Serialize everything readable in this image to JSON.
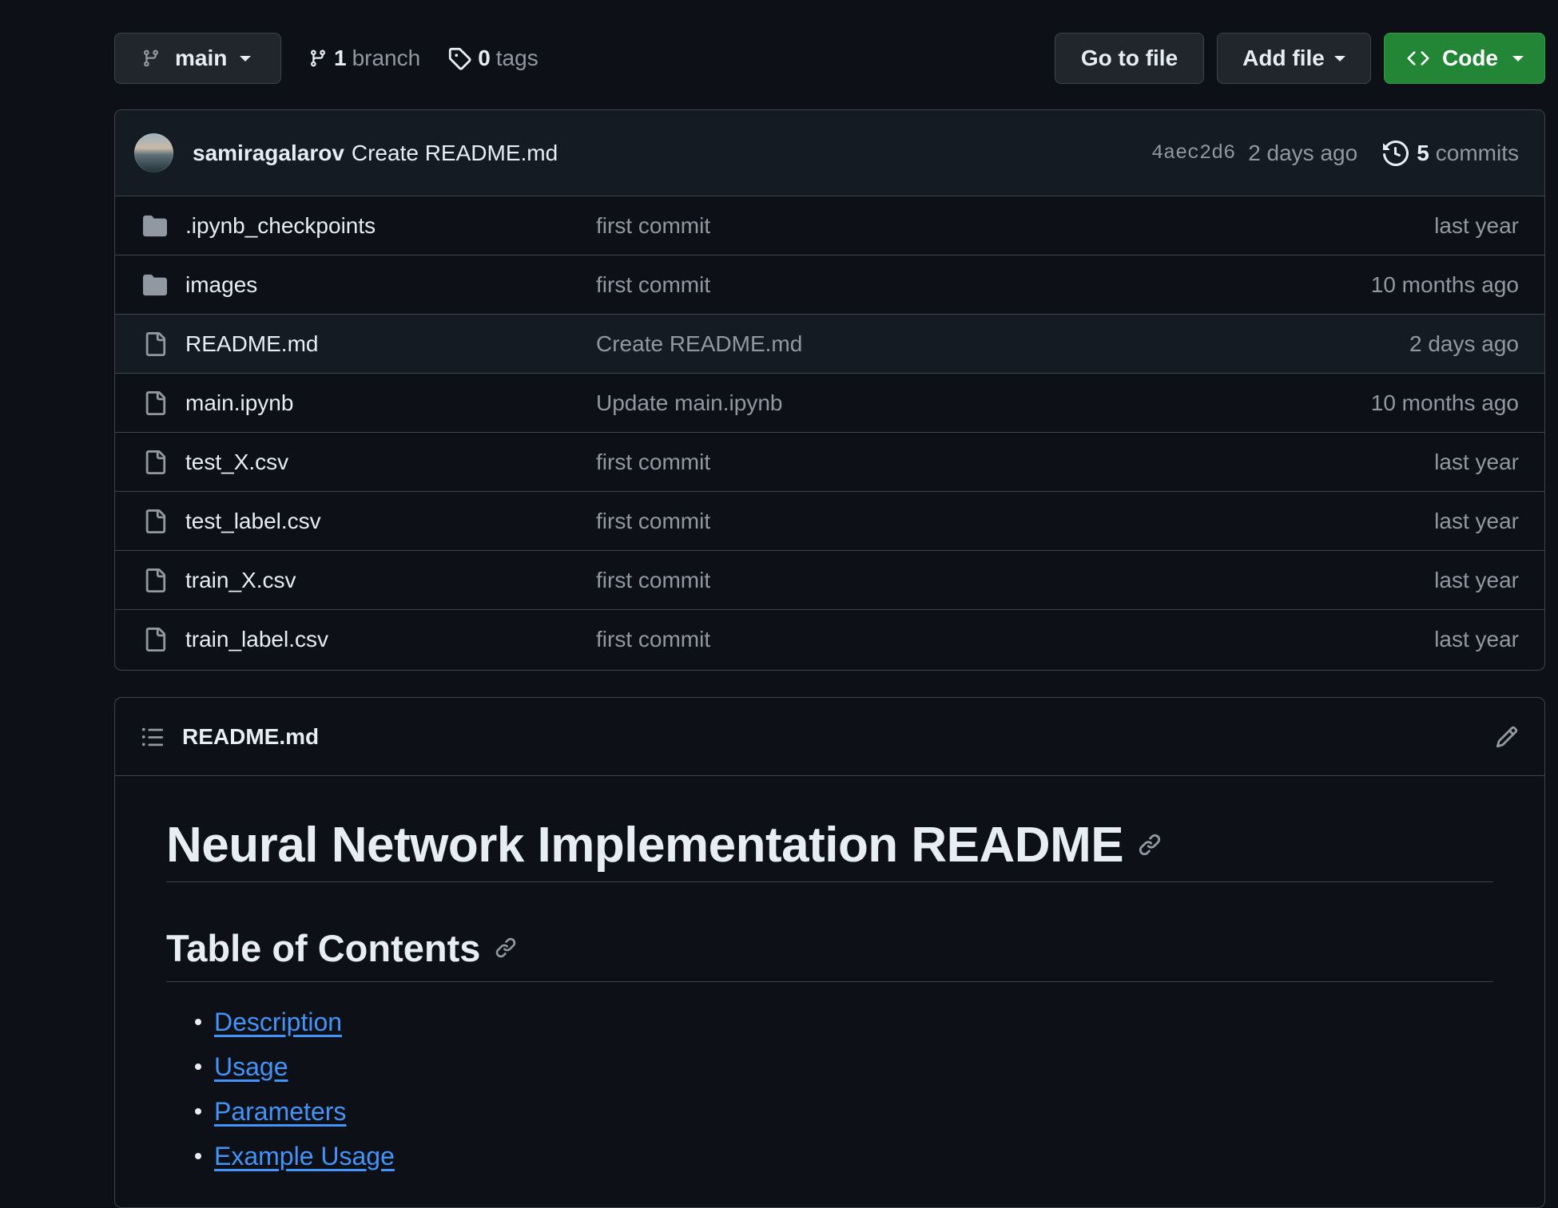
{
  "toolbar": {
    "branch_name": "main",
    "branch_count": "1",
    "branch_label": "branch",
    "tag_count": "0",
    "tag_label": "tags",
    "goto_label": "Go to file",
    "add_label": "Add file",
    "code_label": "Code",
    "code_color": "#238636"
  },
  "latest_commit": {
    "author": "samiragalarov",
    "message": "Create README.md",
    "sha": "4aec2d6",
    "date": "2 days ago",
    "commit_count": "5",
    "commit_label": "commits"
  },
  "files": [
    {
      "type": "folder",
      "name": ".ipynb_checkpoints",
      "message": "first commit",
      "age": "last year"
    },
    {
      "type": "folder",
      "name": "images",
      "message": "first commit",
      "age": "10 months ago"
    },
    {
      "type": "file",
      "name": "README.md",
      "message": "Create README.md",
      "age": "2 days ago"
    },
    {
      "type": "file",
      "name": "main.ipynb",
      "message": "Update main.ipynb",
      "age": "10 months ago"
    },
    {
      "type": "file",
      "name": "test_X.csv",
      "message": "first commit",
      "age": "last year"
    },
    {
      "type": "file",
      "name": "test_label.csv",
      "message": "first commit",
      "age": "last year"
    },
    {
      "type": "file",
      "name": "train_X.csv",
      "message": "first commit",
      "age": "last year"
    },
    {
      "type": "file",
      "name": "train_label.csv",
      "message": "first commit",
      "age": "last year"
    }
  ],
  "readme": {
    "file_title": "README.md",
    "h1": "Neural Network Implementation README",
    "h2": "Table of Contents",
    "toc": [
      "Description",
      "Usage",
      "Parameters",
      "Example Usage"
    ],
    "link_color": "#4493f8"
  }
}
